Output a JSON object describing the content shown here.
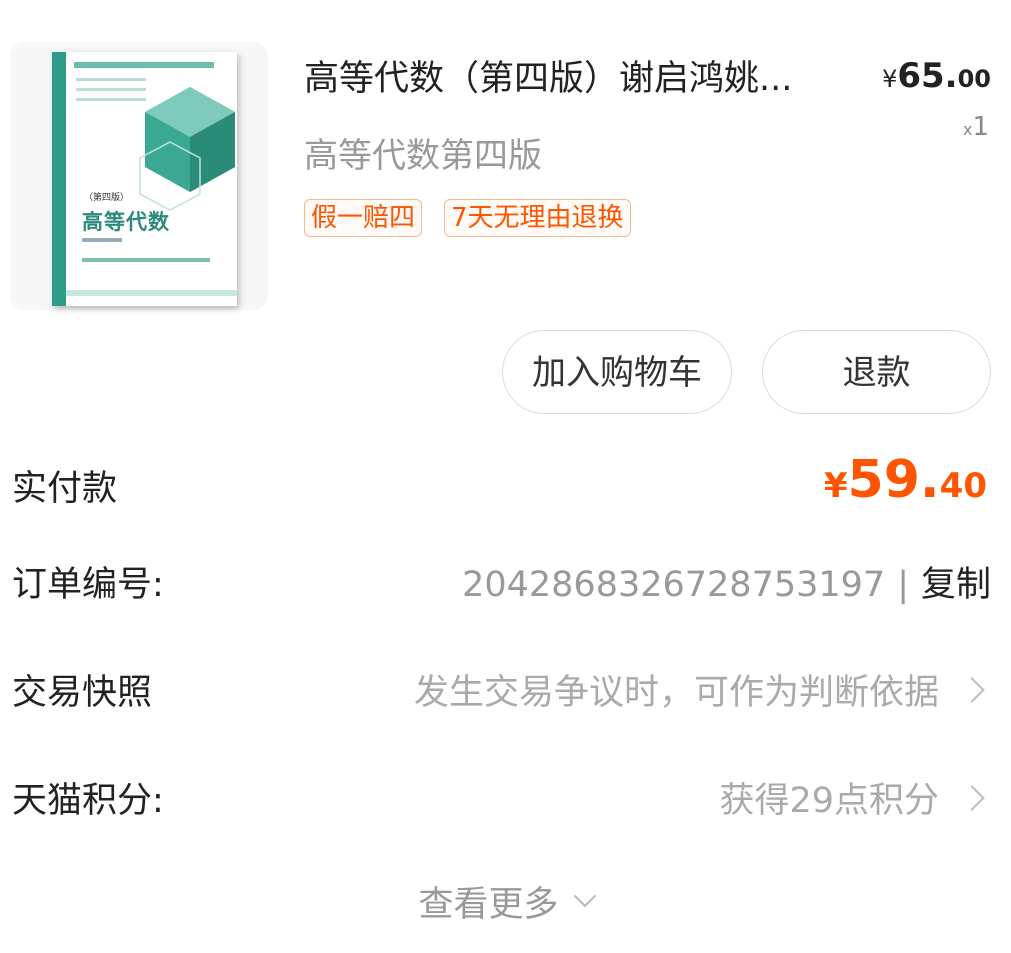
{
  "product": {
    "title": "高等代数（第四版）谢启鸿姚...",
    "spec": "高等代数第四版",
    "price": {
      "currency": "¥",
      "integer": "65.",
      "cents": "00"
    },
    "quantity": {
      "prefix": "x",
      "value": "1"
    },
    "tags": [
      "假一赔四",
      "7天无理由退换"
    ],
    "cover": {
      "edition": "（第四版）",
      "book_title": "高等代数"
    }
  },
  "actions": {
    "add_to_cart": "加入购物车",
    "refund": "退款"
  },
  "payment": {
    "label": "实付款",
    "currency": "¥",
    "integer": "59.",
    "cents": "40"
  },
  "order": {
    "label": "订单编号:",
    "number": "2042868326728753197",
    "separator": "|",
    "copy_label": "复制"
  },
  "snapshot": {
    "label": "交易快照",
    "value": "发生交易争议时，可作为判断依据"
  },
  "points": {
    "label": "天猫积分:",
    "value": "获得29点积分"
  },
  "more": {
    "label": "查看更多"
  },
  "colors": {
    "accent": "#ff5500",
    "muted": "#999999",
    "tag_border": "#f3b98f",
    "cover_green": "#2d8a7a"
  }
}
